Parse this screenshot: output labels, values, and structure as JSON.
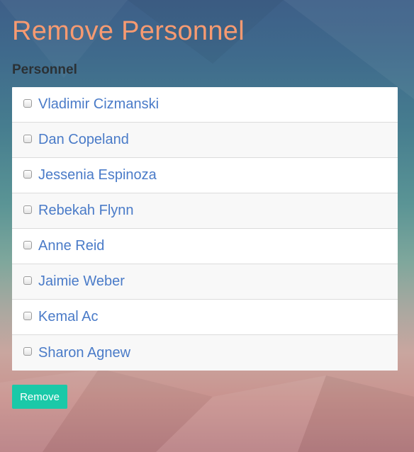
{
  "page": {
    "title": "Remove Personnel",
    "section_label": "Personnel"
  },
  "personnel": [
    {
      "name": "Vladimir Cizmanski",
      "checked": false
    },
    {
      "name": "Dan Copeland",
      "checked": false
    },
    {
      "name": "Jessenia Espinoza",
      "checked": false
    },
    {
      "name": "Rebekah Flynn",
      "checked": false
    },
    {
      "name": "Anne Reid",
      "checked": false
    },
    {
      "name": "Jaimie Weber",
      "checked": false
    },
    {
      "name": "Kemal Ac",
      "checked": false
    },
    {
      "name": "Sharon Agnew",
      "checked": false
    }
  ],
  "actions": {
    "remove_label": "Remove"
  },
  "colors": {
    "title": "#f79a71",
    "link": "#4a7bc8",
    "button": "#1ac9a8"
  }
}
